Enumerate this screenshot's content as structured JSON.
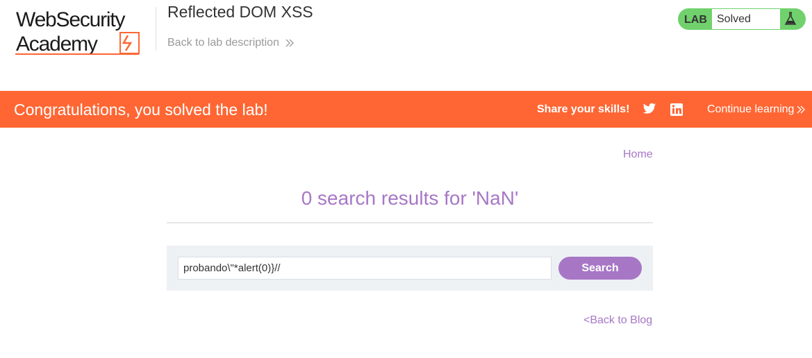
{
  "header": {
    "logo_line1": "WebSecurity",
    "logo_line2": "Academy",
    "lab_title": "Reflected DOM XSS",
    "back_to_description": "Back to lab description"
  },
  "lab_status": {
    "label": "LAB",
    "state": "Solved",
    "icon": "flask-icon",
    "accent": "#70d16d"
  },
  "banner": {
    "message": "Congratulations, you solved the lab!",
    "share_label": "Share your skills!",
    "continue_label": "Continue learning",
    "color": "#ff6633",
    "icons": [
      "twitter-icon",
      "linkedin-icon",
      "double-chevron-right-icon"
    ]
  },
  "nav": {
    "home": "Home"
  },
  "results": {
    "heading": "0 search results for 'NaN'"
  },
  "search": {
    "value": "probando\\\"*alert(0)}//",
    "button_label": "Search"
  },
  "footer": {
    "back_to_blog": "<Back to Blog"
  },
  "colors": {
    "link": "#a777c6",
    "panel": "#eef1f4"
  }
}
